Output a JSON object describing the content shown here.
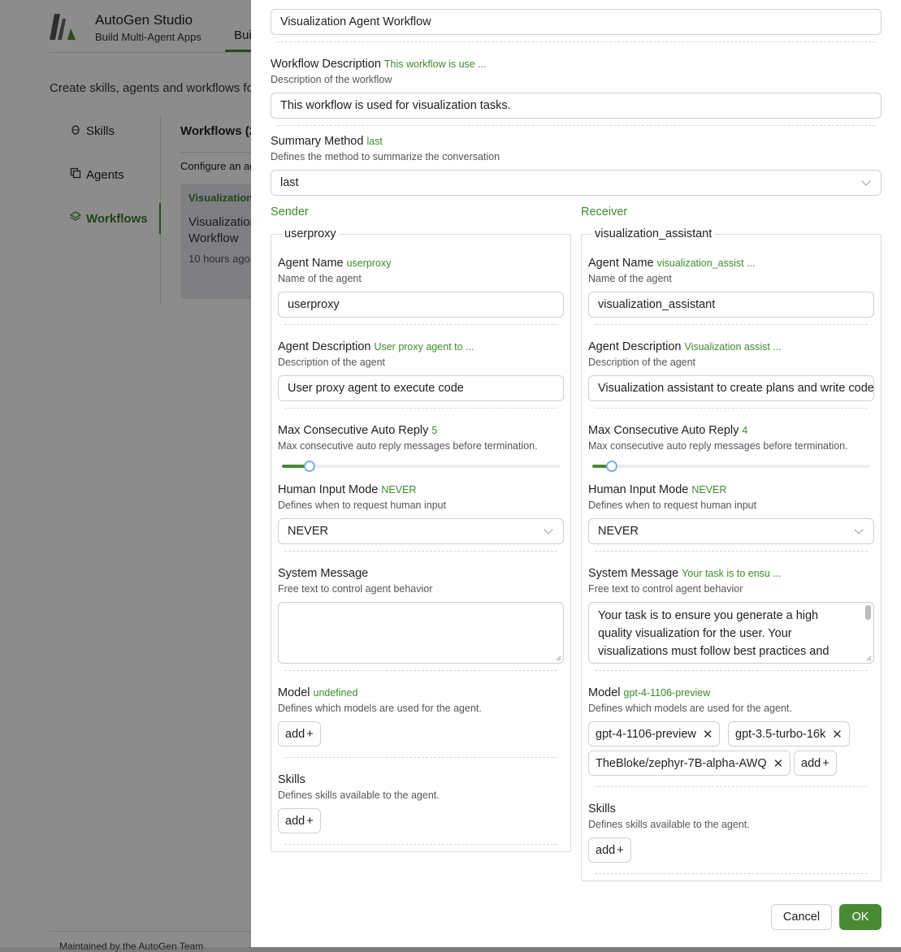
{
  "background": {
    "app_title": "AutoGen Studio",
    "app_subtitle": "Build Multi-Agent Apps",
    "nav_build": "Bui",
    "description": "Create skills, agents and workflows for",
    "sidebar": [
      {
        "label": "Skills",
        "icon": "bug-icon"
      },
      {
        "label": "Agents",
        "icon": "copy-icon"
      },
      {
        "label": "Workflows",
        "icon": "layers-icon"
      }
    ],
    "workflows_title": "Workflows (2",
    "configure_text": "Configure an ag",
    "card": {
      "title": "Visualization",
      "name": "Visualization Workflow",
      "time": "10 hours ago"
    },
    "footer": "Maintained by the AutoGen Team"
  },
  "drawer": {
    "workflow_name_value": "Visualization Agent Workflow",
    "description": {
      "label": "Workflow Description",
      "value_preview": "This workflow is use ...",
      "hint": "Description of the workflow",
      "value": "This workflow is used for visualization tasks."
    },
    "summary": {
      "label": "Summary Method",
      "value_preview": "last",
      "hint": "Defines the method to summarize the conversation",
      "value": "last"
    },
    "sender": {
      "section_title": "Sender",
      "legend": "userproxy",
      "agent_name": {
        "label": "Agent Name",
        "preview": "userproxy",
        "hint": "Name of the agent",
        "value": "userproxy"
      },
      "agent_description": {
        "label": "Agent Description",
        "preview": "User proxy agent to ...",
        "hint": "Description of the agent",
        "value": "User proxy agent to execute code"
      },
      "max_reply": {
        "label": "Max Consecutive Auto Reply",
        "preview": "5",
        "hint": "Max consecutive auto reply messages before termination.",
        "fraction": 0.1
      },
      "human_input": {
        "label": "Human Input Mode",
        "preview": "NEVER",
        "hint": "Defines when to request human input",
        "value": "NEVER"
      },
      "system_message": {
        "label": "System Message",
        "preview": "",
        "hint": "Free text to control agent behavior",
        "value": ""
      },
      "model": {
        "label": "Model",
        "preview": "undefined",
        "hint": "Defines which models are used for the agent.",
        "add": "add"
      },
      "skills": {
        "label": "Skills",
        "hint": "Defines skills available to the agent.",
        "add": "add"
      }
    },
    "receiver": {
      "section_title": "Receiver",
      "legend": "visualization_assistant",
      "agent_name": {
        "label": "Agent Name",
        "preview": "visualization_assist ...",
        "hint": "Name of the agent",
        "value": "visualization_assistant"
      },
      "agent_description": {
        "label": "Agent Description",
        "preview": "Visualization assist ...",
        "hint": "Description of the agent",
        "value": "Visualization assistant to create plans and write code"
      },
      "max_reply": {
        "label": "Max Consecutive Auto Reply",
        "preview": "4",
        "hint": "Max consecutive auto reply messages before termination.",
        "fraction": 0.07
      },
      "human_input": {
        "label": "Human Input Mode",
        "preview": "NEVER",
        "hint": "Defines when to request human input",
        "value": "NEVER"
      },
      "system_message": {
        "label": "System Message",
        "preview": "Your task is to ensu ...",
        "hint": "Free text to control agent behavior",
        "value": "Your task is to ensure you generate a high quality visualization for the user. Your visualizations must follow best practices and"
      },
      "model": {
        "label": "Model",
        "preview": "gpt-4-1106-preview",
        "hint": "Defines which models are used for the agent.",
        "tags": [
          "gpt-4-1106-preview",
          "gpt-3.5-turbo-16k",
          "TheBloke/zephyr-7B-alpha-AWQ"
        ],
        "add": "add"
      },
      "skills": {
        "label": "Skills",
        "hint": "Defines skills available to the agent.",
        "add": "add"
      }
    },
    "footer": {
      "cancel": "Cancel",
      "ok": "OK"
    },
    "colors": {
      "accent": "#4a8a34",
      "value_green": "#3f8a2c",
      "slider_handle": "#7ab0e0"
    }
  }
}
